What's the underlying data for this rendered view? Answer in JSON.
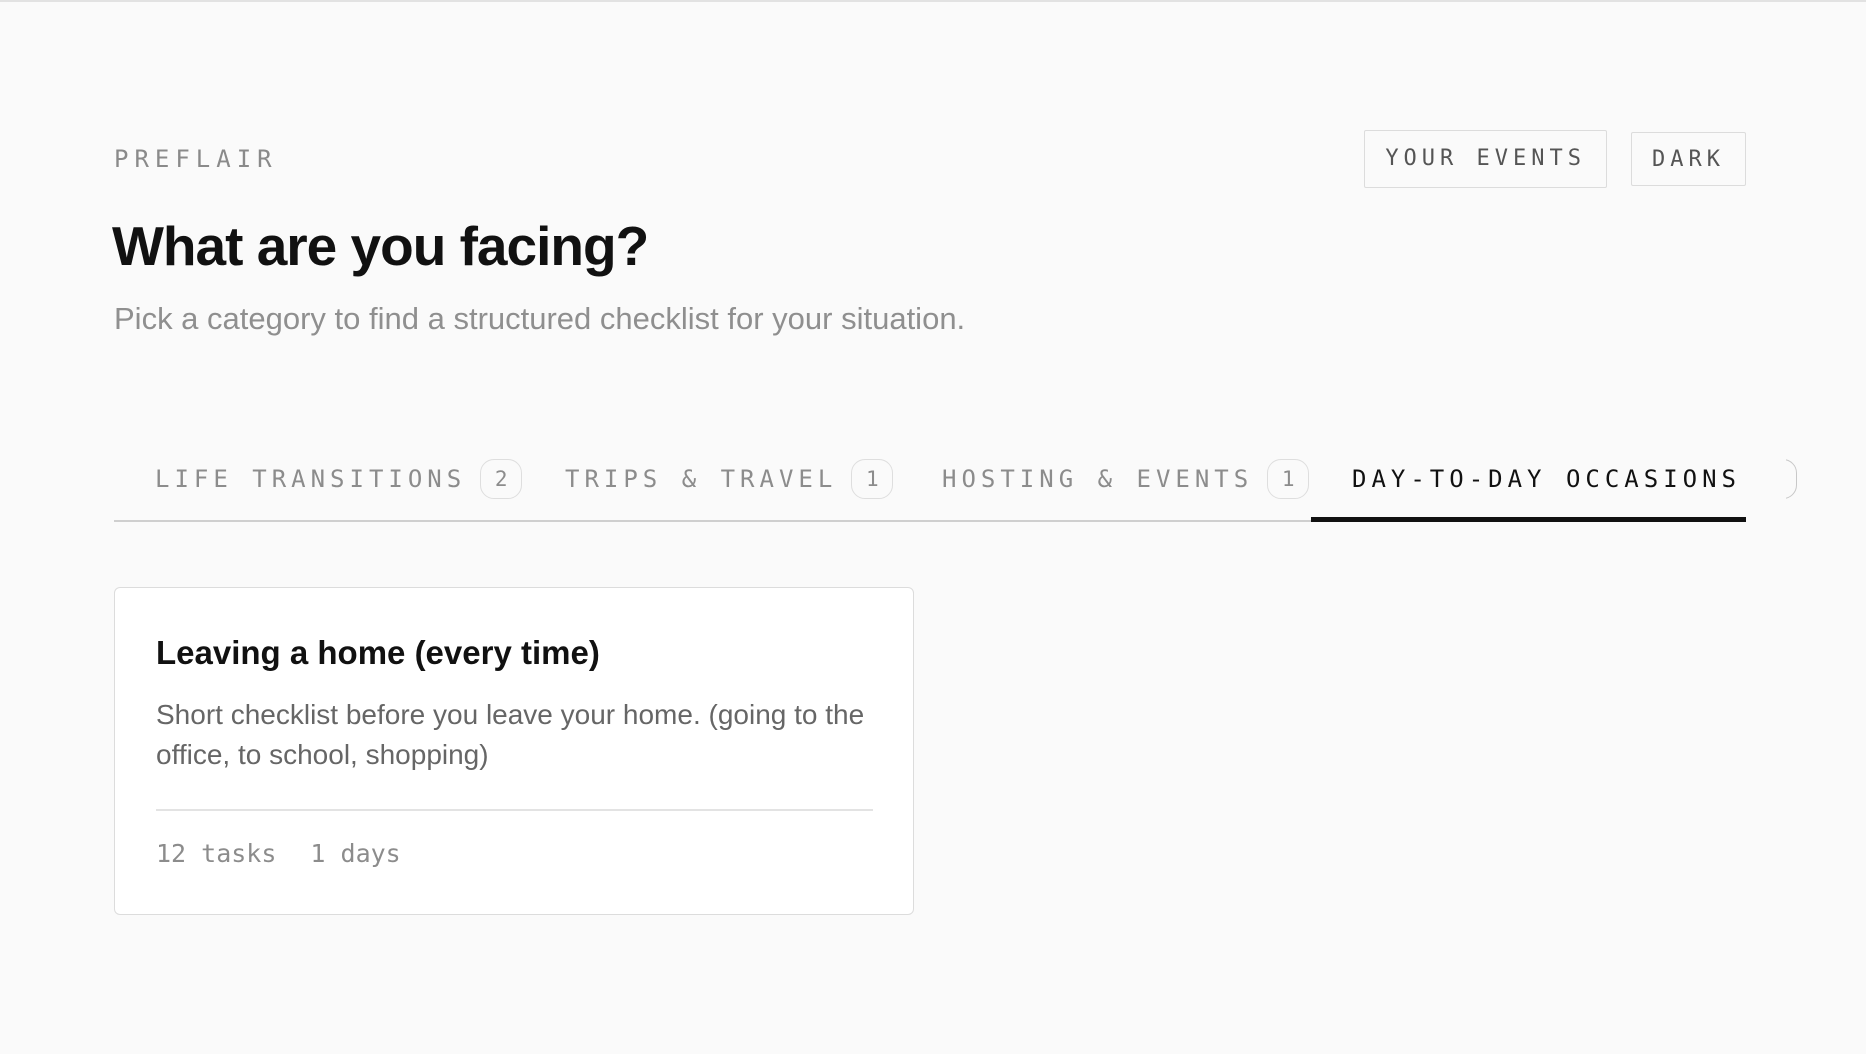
{
  "brand": "PREFLAIR",
  "header": {
    "events_label": "YOUR EVENTS",
    "theme_label": "DARK"
  },
  "hero": {
    "title": "What are you facing?",
    "subtitle": "Pick a category to find a structured checklist for your situation."
  },
  "tabs": [
    {
      "label": "LIFE TRANSITIONS",
      "count": "2",
      "active": false
    },
    {
      "label": "TRIPS & TRAVEL",
      "count": "1",
      "active": false
    },
    {
      "label": "HOSTING & EVENTS",
      "count": "1",
      "active": false
    },
    {
      "label": "DAY-TO-DAY OCCASIONS",
      "count": "1",
      "active": true
    }
  ],
  "cards": [
    {
      "title": "Leaving a home (every time)",
      "description": "Short checklist before you leave your home. (going to the office, to school, shopping)",
      "tasks": "12 tasks",
      "duration": "1 days"
    }
  ]
}
